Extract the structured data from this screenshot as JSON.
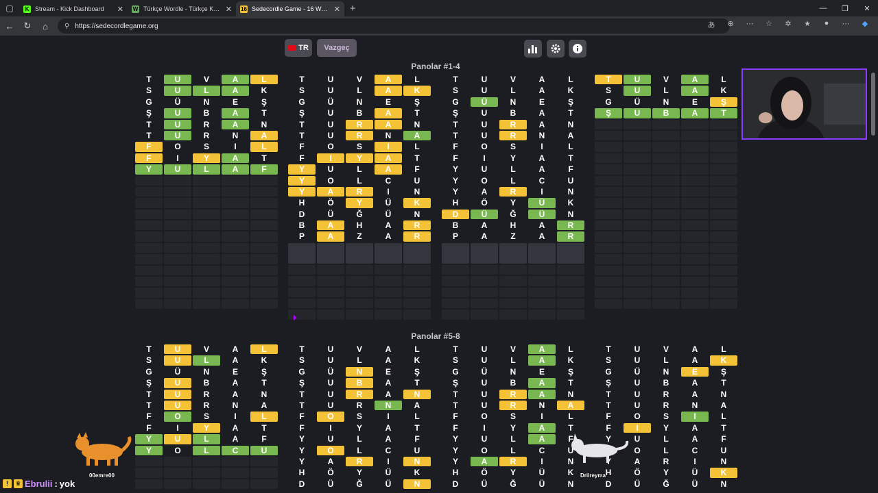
{
  "browser": {
    "tabs": [
      {
        "title": "Stream - Kick Dashboard",
        "fav": "K",
        "fav_color": "#53fc18",
        "active": false
      },
      {
        "title": "Türkçe Wordle - Türkçe Kelimeler",
        "fav": "W",
        "fav_color": "#6aaa64",
        "active": false
      },
      {
        "title": "Sedecordle Game - 16 Words Wo",
        "fav": "16",
        "fav_color": "#f3c237",
        "active": true
      }
    ],
    "url": "https://sedecordlegame.org",
    "new_tab": "+",
    "controls": [
      "—",
      "❐",
      "✕"
    ]
  },
  "toolbar": {
    "lang": "TR",
    "cancel": "Vazgeç",
    "icons": [
      "stats-icon",
      "settings-icon",
      "info-icon"
    ]
  },
  "sections": [
    {
      "title": "Panolar #1-4",
      "boards": [
        {
          "rows": [
            [
              "T.",
              "U:g",
              "V.",
              "A:g",
              "L:y"
            ],
            [
              "S.",
              "U:g",
              "L:g",
              "A:g",
              "K."
            ],
            [
              "G.",
              "Ü.",
              "N.",
              "E.",
              "Ş."
            ],
            [
              "Ş.",
              "U:g",
              "B.",
              "A:g",
              "T."
            ],
            [
              "T.",
              "U:g",
              "R.",
              "A:g",
              "N."
            ],
            [
              "T.",
              "U:g",
              "R.",
              "N.",
              "A:y"
            ],
            [
              "F:y",
              "O.",
              "S.",
              "I.",
              "L:y"
            ],
            [
              "F:y",
              "I.",
              "Y:y",
              "A:g",
              "T."
            ],
            [
              "Y:g",
              "U:g",
              "L:g",
              "A:g",
              "F:g"
            ]
          ],
          "done": true
        },
        {
          "rows": [
            [
              "T.",
              "U.",
              "V.",
              "A:y",
              "L."
            ],
            [
              "S.",
              "U.",
              "L.",
              "A:y",
              "K:y"
            ],
            [
              "G.",
              "Ü.",
              "N.",
              "E.",
              "Ş."
            ],
            [
              "Ş.",
              "U.",
              "B.",
              "A:y",
              "T."
            ],
            [
              "T.",
              "U.",
              "R:y",
              "A:y",
              "N."
            ],
            [
              "T.",
              "U.",
              "R:y",
              "N.",
              "A:g"
            ],
            [
              "F.",
              "O.",
              "S.",
              "I:y",
              "L."
            ],
            [
              "F.",
              "I:y",
              "Y:y",
              "A:y",
              "T."
            ],
            [
              "Y:y",
              "U.",
              "L.",
              "A:y",
              "F."
            ],
            [
              "Y:y",
              "O.",
              "L.",
              "C.",
              "U."
            ],
            [
              "Y:y",
              "A:y",
              "R:y",
              "I.",
              "N."
            ],
            [
              "H.",
              "Ö.",
              "Y:y",
              "Ü.",
              "K:y"
            ],
            [
              "D.",
              "Ü.",
              "Ğ.",
              "Ü.",
              "N."
            ],
            [
              "B.",
              "A:y",
              "H.",
              "A.",
              "R:y"
            ],
            [
              "P.",
              "A:y",
              "Z.",
              "A.",
              "R:y"
            ]
          ],
          "done": false
        },
        {
          "rows": [
            [
              "T.",
              "U.",
              "V.",
              "A.",
              "L."
            ],
            [
              "S.",
              "U.",
              "L.",
              "A.",
              "K."
            ],
            [
              "G.",
              "Ü:g",
              "N.",
              "E.",
              "Ş."
            ],
            [
              "Ş.",
              "U.",
              "B.",
              "A.",
              "T."
            ],
            [
              "T.",
              "U.",
              "R:y",
              "A.",
              "N."
            ],
            [
              "T.",
              "U.",
              "R:y",
              "N.",
              "A."
            ],
            [
              "F.",
              "O.",
              "S.",
              "I.",
              "L."
            ],
            [
              "F.",
              "I.",
              "Y.",
              "A.",
              "T."
            ],
            [
              "Y.",
              "U.",
              "L.",
              "A.",
              "F."
            ],
            [
              "Y.",
              "O.",
              "L.",
              "C.",
              "U."
            ],
            [
              "Y.",
              "A.",
              "R:y",
              "I.",
              "N."
            ],
            [
              "H.",
              "Ö.",
              "Y.",
              "Ü:g",
              "K."
            ],
            [
              "D:y",
              "Ü:g",
              "Ğ.",
              "Ü:g",
              "N."
            ],
            [
              "B.",
              "A.",
              "H.",
              "A.",
              "R:g"
            ],
            [
              "P.",
              "A.",
              "Z.",
              "A.",
              "R:g"
            ]
          ],
          "done": false
        },
        {
          "rows": [
            [
              "T:y",
              "U:g",
              "V.",
              "A:g",
              "L."
            ],
            [
              "S.",
              "U:g",
              "L.",
              "A:g",
              "K."
            ],
            [
              "G.",
              "Ü.",
              "N.",
              "E.",
              "Ş:y"
            ],
            [
              "Ş:g",
              "U:g",
              "B:g",
              "A:g",
              "T:g"
            ]
          ],
          "done": true
        }
      ]
    },
    {
      "title": "Panolar #5-8",
      "boards": [
        {
          "rows": [
            [
              "T.",
              "U:y",
              "V.",
              "A.",
              "L:y"
            ],
            [
              "S.",
              "U:y",
              "L:g",
              "A.",
              "K."
            ],
            [
              "G.",
              "Ü.",
              "N.",
              "E.",
              "Ş."
            ],
            [
              "Ş.",
              "U:y",
              "B.",
              "A.",
              "T."
            ],
            [
              "T.",
              "U:y",
              "R.",
              "A.",
              "N."
            ],
            [
              "T.",
              "U:y",
              "R.",
              "N.",
              "A."
            ],
            [
              "F.",
              "O:g",
              "S.",
              "I.",
              "L:y"
            ],
            [
              "F.",
              "I.",
              "Y:y",
              "A.",
              "T."
            ],
            [
              "Y:g",
              "U:y",
              "L:g",
              "A.",
              "F."
            ],
            [
              "Y:g",
              "O.",
              "L:g",
              "C:g",
              "U:g"
            ]
          ],
          "done": true
        },
        {
          "rows": [
            [
              "T.",
              "U.",
              "V.",
              "A.",
              "L."
            ],
            [
              "S.",
              "U.",
              "L.",
              "A.",
              "K."
            ],
            [
              "G.",
              "Ü.",
              "N:y",
              "E.",
              "Ş."
            ],
            [
              "Ş.",
              "U.",
              "B:y",
              "A.",
              "T."
            ],
            [
              "T.",
              "U.",
              "R:y",
              "A.",
              "N:y"
            ],
            [
              "T.",
              "U.",
              "R.",
              "N:g",
              "A."
            ],
            [
              "F.",
              "O:y",
              "S.",
              "I.",
              "L."
            ],
            [
              "F.",
              "I.",
              "Y.",
              "A.",
              "T."
            ],
            [
              "Y.",
              "U.",
              "L.",
              "A.",
              "F."
            ],
            [
              "Y.",
              "O:y",
              "L.",
              "C.",
              "U."
            ],
            [
              "Y.",
              "A.",
              "R:y",
              "I.",
              "N:y"
            ],
            [
              "H.",
              "Ö.",
              "Y.",
              "Ü.",
              "K."
            ],
            [
              "D.",
              "Ü.",
              "Ğ.",
              "Ü.",
              "N:y"
            ]
          ],
          "done": false
        },
        {
          "rows": [
            [
              "T.",
              "U.",
              "V.",
              "A:g",
              "L."
            ],
            [
              "S.",
              "U.",
              "L.",
              "A:g",
              "K."
            ],
            [
              "G.",
              "Ü.",
              "N.",
              "E.",
              "Ş."
            ],
            [
              "Ş.",
              "U.",
              "B.",
              "A:g",
              "T."
            ],
            [
              "T.",
              "U.",
              "R:y",
              "A:g",
              "N."
            ],
            [
              "T.",
              "U.",
              "R:y",
              "N.",
              "A:y"
            ],
            [
              "F.",
              "O.",
              "S.",
              "I.",
              "L."
            ],
            [
              "F.",
              "I.",
              "Y.",
              "A:g",
              "T."
            ],
            [
              "Y.",
              "U.",
              "L.",
              "A:g",
              "F."
            ],
            [
              "Y.",
              "O.",
              "L.",
              "C.",
              "U."
            ],
            [
              "Y.",
              "A:g",
              "R:y",
              "I.",
              "N."
            ],
            [
              "H.",
              "Ö.",
              "Y.",
              "Ü.",
              "K."
            ],
            [
              "D.",
              "Ü.",
              "Ğ.",
              "Ü.",
              "N."
            ]
          ],
          "done": false
        },
        {
          "rows": [
            [
              "T.",
              "U.",
              "V.",
              "A.",
              "L."
            ],
            [
              "S.",
              "U.",
              "L.",
              "A.",
              "K:y"
            ],
            [
              "G.",
              "Ü.",
              "N.",
              "E:y",
              "Ş."
            ],
            [
              "Ş.",
              "U.",
              "B.",
              "A.",
              "T."
            ],
            [
              "T.",
              "U.",
              "R.",
              "A.",
              "N."
            ],
            [
              "T.",
              "U.",
              "R.",
              "N.",
              "A."
            ],
            [
              "F.",
              "O.",
              "S.",
              "I:g",
              "L."
            ],
            [
              "F.",
              "I:y",
              "Y.",
              "A.",
              "T."
            ],
            [
              "Y.",
              "U.",
              "L.",
              "A.",
              "F."
            ],
            [
              "Y.",
              "O.",
              "L.",
              "C.",
              "U."
            ],
            [
              "Y.",
              "A.",
              "R.",
              "I.",
              "N."
            ],
            [
              "H.",
              "Ö.",
              "Y.",
              "Ü.",
              "K:y"
            ],
            [
              "D.",
              "Ü.",
              "Ğ.",
              "Ü.",
              "N."
            ]
          ],
          "done": false
        }
      ]
    }
  ],
  "overlays": {
    "chat_user": "Ebrulii",
    "chat_sep": " :",
    "chat_msg": "yok",
    "pet1_name": "00emre00",
    "pet2_name": "Drilreyma"
  }
}
